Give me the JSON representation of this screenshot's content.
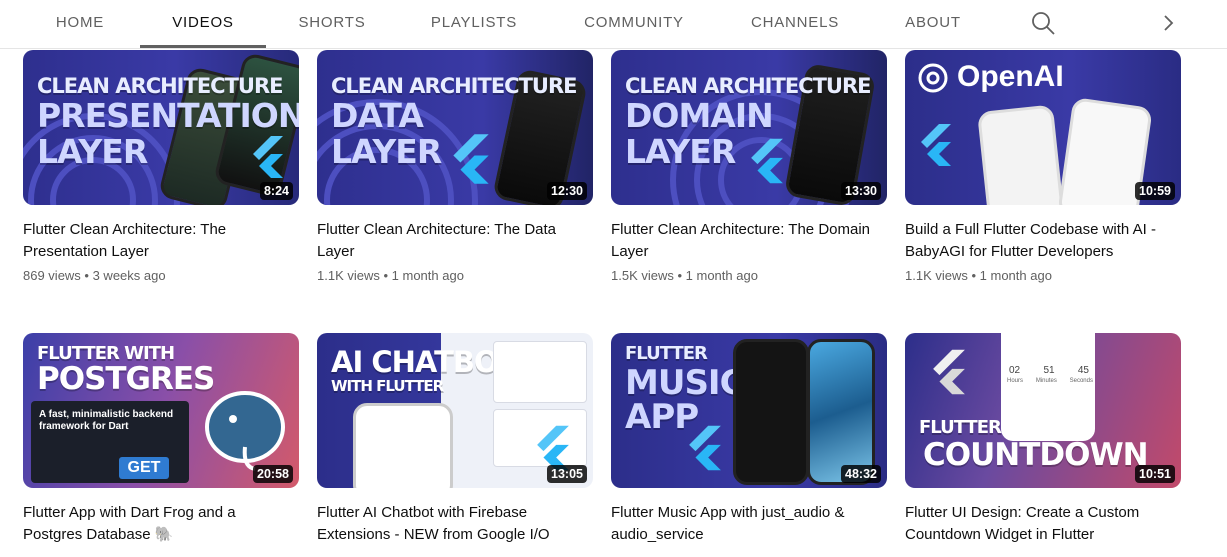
{
  "tabs": [
    "HOME",
    "VIDEOS",
    "SHORTS",
    "PLAYLISTS",
    "COMMUNITY",
    "CHANNELS",
    "ABOUT"
  ],
  "active_tab": "VIDEOS",
  "icons": {
    "search": "search-icon",
    "next": "chevron-right-icon"
  },
  "videos": [
    {
      "duration": "8:24",
      "title": "Flutter Clean Architecture: The Presentation Layer",
      "views": "869 views",
      "age": "3 weeks ago",
      "thumb": {
        "lines": [
          "CLEAN ARCHITECTURE",
          "PRESENTATION",
          "LAYER"
        ]
      }
    },
    {
      "duration": "12:30",
      "title": "Flutter Clean Architecture: The Data Layer",
      "views": "1.1K views",
      "age": "1 month ago",
      "thumb": {
        "lines": [
          "CLEAN ARCHITECTURE",
          "DATA",
          "LAYER"
        ]
      }
    },
    {
      "duration": "13:30",
      "title": "Flutter Clean Architecture: The Domain Layer",
      "views": "1.5K views",
      "age": "1 month ago",
      "thumb": {
        "lines": [
          "CLEAN ARCHITECTURE",
          "DOMAIN",
          "LAYER"
        ]
      }
    },
    {
      "duration": "10:59",
      "title": "Build a Full Flutter Codebase with AI - BabyAGI for Flutter Developers",
      "views": "1.1K views",
      "age": "1 month ago",
      "thumb": {
        "lines": [
          "OpenAI"
        ]
      }
    },
    {
      "duration": "20:58",
      "title": "Flutter App with Dart Frog and a Postgres Database 🐘",
      "views": "",
      "age": "",
      "thumb": {
        "lines": [
          "FLUTTER WITH",
          "POSTGRES"
        ],
        "tagline": "A fast, minimalistic backend framework for Dart",
        "button": "GET"
      }
    },
    {
      "duration": "13:05",
      "title": "Flutter AI Chatbot with Firebase Extensions - NEW from Google I/O",
      "views": "",
      "age": "",
      "thumb": {
        "lines": [
          "AI CHATBOT",
          "WITH FLUTTER"
        ]
      }
    },
    {
      "duration": "48:32",
      "title": "Flutter Music App with just_audio & audio_service",
      "views": "",
      "age": "",
      "thumb": {
        "lines": [
          "FLUTTER",
          "MUSIC",
          "APP"
        ]
      }
    },
    {
      "duration": "10:51",
      "title": "Flutter UI Design: Create a Custom Countdown Widget in Flutter",
      "views": "",
      "age": "",
      "thumb": {
        "lines": [
          "FLUTTER",
          "COUNTDOWN"
        ],
        "countdown": [
          "02",
          "51",
          "45"
        ],
        "countdown_units": [
          "Hours",
          "Minutes",
          "Seconds"
        ]
      }
    }
  ],
  "colors": {
    "accent": "#0f0f0f",
    "meta": "#606060",
    "thumb_blue": "#2b2d8f",
    "flutter_blue": "#42a5f5"
  }
}
